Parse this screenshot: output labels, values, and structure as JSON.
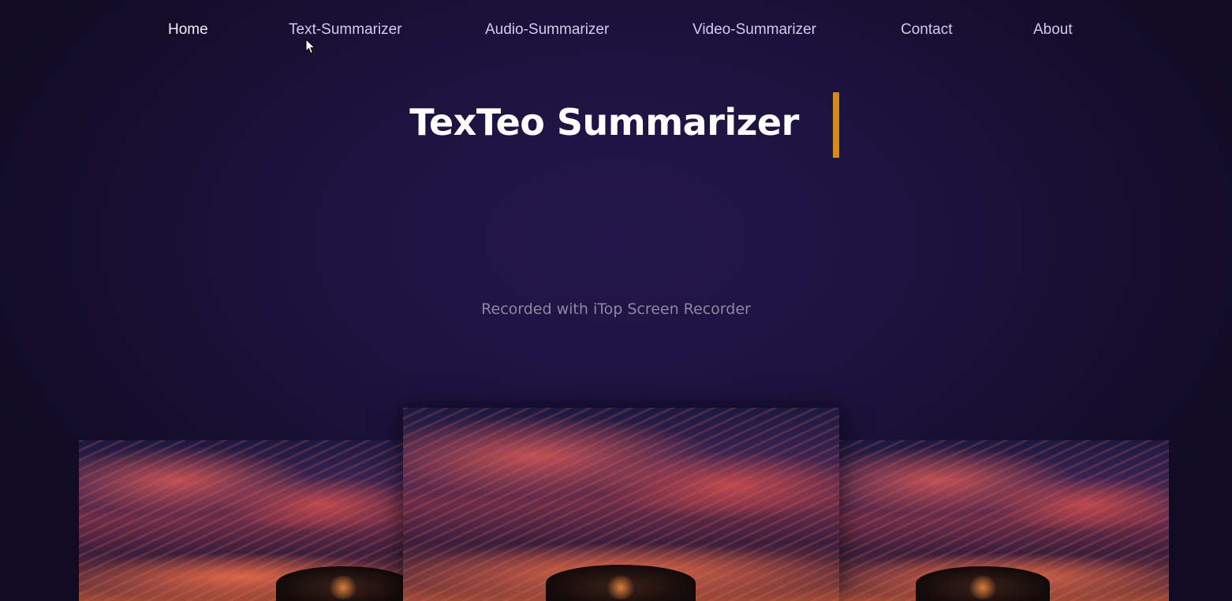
{
  "nav": {
    "items": [
      {
        "label": "Home"
      },
      {
        "label": "Text-Summarizer"
      },
      {
        "label": "Audio-Summarizer"
      },
      {
        "label": "Video-Summarizer"
      },
      {
        "label": "Contact"
      },
      {
        "label": "About"
      }
    ]
  },
  "hero": {
    "title": "TexTeo Summarizer"
  },
  "watermark": {
    "text": "Recorded with iTop Screen Recorder"
  },
  "gallery": {
    "image_icon": "sunset-sky-with-tree-image",
    "count": 3
  },
  "colors": {
    "background": "#1d1340",
    "caret": "#d48a19",
    "nav_text": "#d6c8ef",
    "title_text": "#ffffff"
  }
}
